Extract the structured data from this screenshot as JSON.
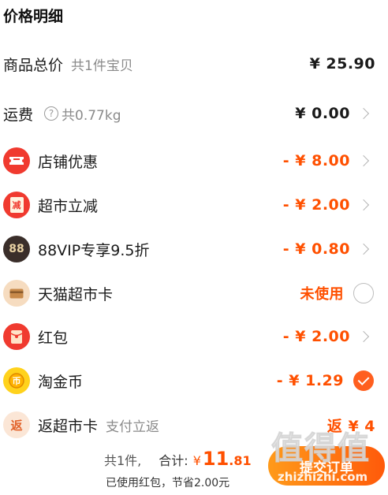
{
  "title": "价格明细",
  "rows": [
    {
      "label": "商品总价",
      "sub": "共1件宝贝",
      "amount": "¥ 25.90"
    },
    {
      "label": "运费",
      "sub": "共0.77kg",
      "help_icon": "?",
      "amount": "¥ 0.00"
    },
    {
      "label": "店铺优惠",
      "icon": "ticket-icon",
      "amount": "- ¥ 8.00"
    },
    {
      "label": "超市立减",
      "icon": "jian-icon",
      "icon_text": "减",
      "amount": "- ¥ 2.00"
    },
    {
      "label": "88VIP专享9.5折",
      "icon": "88vip-icon",
      "icon_text": "88",
      "amount": "- ¥ 0.80"
    },
    {
      "label": "天猫超市卡",
      "icon": "card-icon",
      "amount": "未使用"
    },
    {
      "label": "红包",
      "icon": "red-envelope-icon",
      "amount": "- ¥ 2.00"
    },
    {
      "label": "淘金币",
      "icon": "gold-coin-icon",
      "amount": "- ¥ 1.29"
    },
    {
      "label": "返超市卡",
      "sub": "支付立返",
      "icon": "fan-icon",
      "icon_text": "返",
      "amount": "返 ¥ 4"
    }
  ],
  "footer": {
    "count": "共1件,",
    "total_label": "合计:",
    "currency": "¥",
    "total_int": "11",
    "total_dec": ".81",
    "savings": "已使用红包，节省2.00元",
    "submit_label": "提交订单"
  },
  "watermark": {
    "big": "值得值",
    "small": "zhizhizhi.com"
  },
  "colors": {
    "accent": "#ff5000",
    "badge_red": "#f03a2f",
    "gold": "#ffd21c"
  }
}
